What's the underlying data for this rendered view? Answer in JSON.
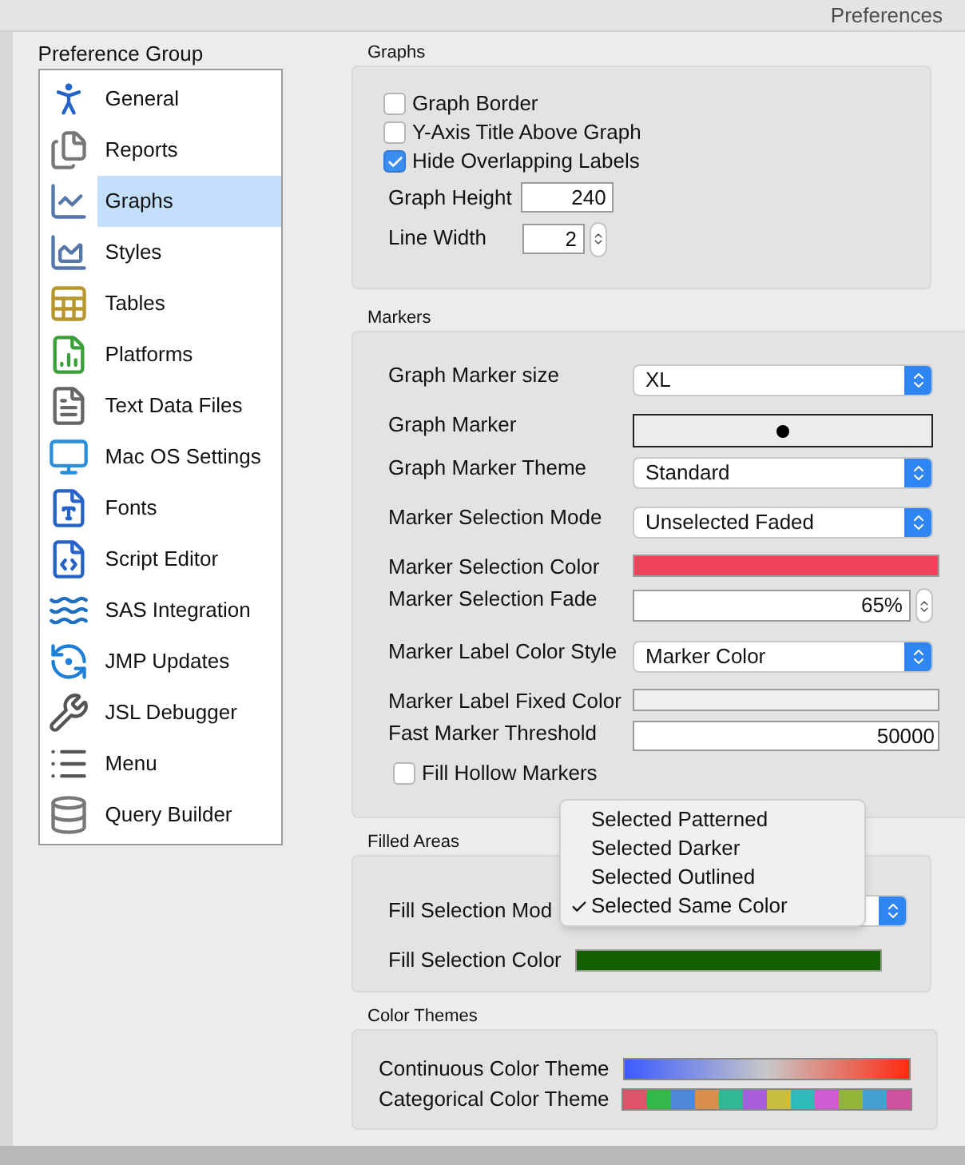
{
  "window": {
    "title": "Preferences"
  },
  "sidebar": {
    "title": "Preference Group",
    "items": [
      {
        "label": "General",
        "selected": false
      },
      {
        "label": "Reports",
        "selected": false
      },
      {
        "label": "Graphs",
        "selected": true
      },
      {
        "label": "Styles",
        "selected": false
      },
      {
        "label": "Tables",
        "selected": false
      },
      {
        "label": "Platforms",
        "selected": false
      },
      {
        "label": "Text Data Files",
        "selected": false
      },
      {
        "label": "Mac OS Settings",
        "selected": false
      },
      {
        "label": "Fonts",
        "selected": false
      },
      {
        "label": "Script Editor",
        "selected": false
      },
      {
        "label": "SAS Integration",
        "selected": false
      },
      {
        "label": "JMP Updates",
        "selected": false
      },
      {
        "label": "JSL Debugger",
        "selected": false
      },
      {
        "label": "Menu",
        "selected": false
      },
      {
        "label": "Query Builder",
        "selected": false
      }
    ]
  },
  "graphs": {
    "title": "Graphs",
    "checkboxes": [
      {
        "label": "Graph Border",
        "checked": false
      },
      {
        "label": "Y-Axis Title Above Graph",
        "checked": false
      },
      {
        "label": "Hide Overlapping Labels",
        "checked": true
      }
    ],
    "graph_height": {
      "label": "Graph Height",
      "value": "240"
    },
    "line_width": {
      "label": "Line Width",
      "value": "2"
    }
  },
  "markers": {
    "title": "Markers",
    "rows": [
      {
        "kind": "select",
        "label": "Graph Marker size",
        "value": "XL"
      },
      {
        "kind": "marker",
        "label": "Graph Marker"
      },
      {
        "kind": "select",
        "label": "Graph Marker Theme",
        "value": "Standard"
      },
      {
        "kind": "select",
        "label": "Marker Selection Mode",
        "value": "Unselected Faded"
      },
      {
        "kind": "color",
        "label": "Marker Selection Color",
        "color": "#f0435a"
      },
      {
        "kind": "stepper",
        "label": "Marker Selection Fade",
        "value": "65%"
      },
      {
        "kind": "select",
        "label": "Marker Label Color Style",
        "value": "Marker Color"
      },
      {
        "kind": "color",
        "label": "Marker Label Fixed Color",
        "color": "#efefef"
      },
      {
        "kind": "number",
        "label": "Fast Marker Threshold",
        "value": "50000"
      }
    ],
    "checkbox": {
      "label": "Fill Hollow Markers",
      "checked": false
    }
  },
  "filled_areas": {
    "title": "Filled Areas",
    "rows": [
      {
        "kind": "select",
        "label": "Fill Selection Mod"
      },
      {
        "kind": "color",
        "label": "Fill Selection Color",
        "color": "#136000"
      }
    ],
    "menu": {
      "options": [
        {
          "label": "Selected Patterned",
          "selected": false
        },
        {
          "label": "Selected Darker",
          "selected": false
        },
        {
          "label": "Selected Outlined",
          "selected": false
        },
        {
          "label": "Selected Same Color",
          "selected": true
        }
      ]
    }
  },
  "color_themes": {
    "title": "Color Themes",
    "continuous": {
      "label": "Continuous Color Theme"
    },
    "categorical": {
      "label": "Categorical Color Theme",
      "swatches": [
        {
          "color": "#de5468"
        },
        {
          "color": "#34b84a"
        },
        {
          "color": "#4f86d8"
        },
        {
          "color": "#d88f4e"
        },
        {
          "color": "#2fb893"
        },
        {
          "color": "#a75ddc"
        },
        {
          "color": "#c8bd3f"
        },
        {
          "color": "#2fb9b8"
        },
        {
          "color": "#cf5bd0"
        },
        {
          "color": "#93b537"
        },
        {
          "color": "#45a0cf"
        },
        {
          "color": "#cf529f"
        }
      ]
    }
  }
}
